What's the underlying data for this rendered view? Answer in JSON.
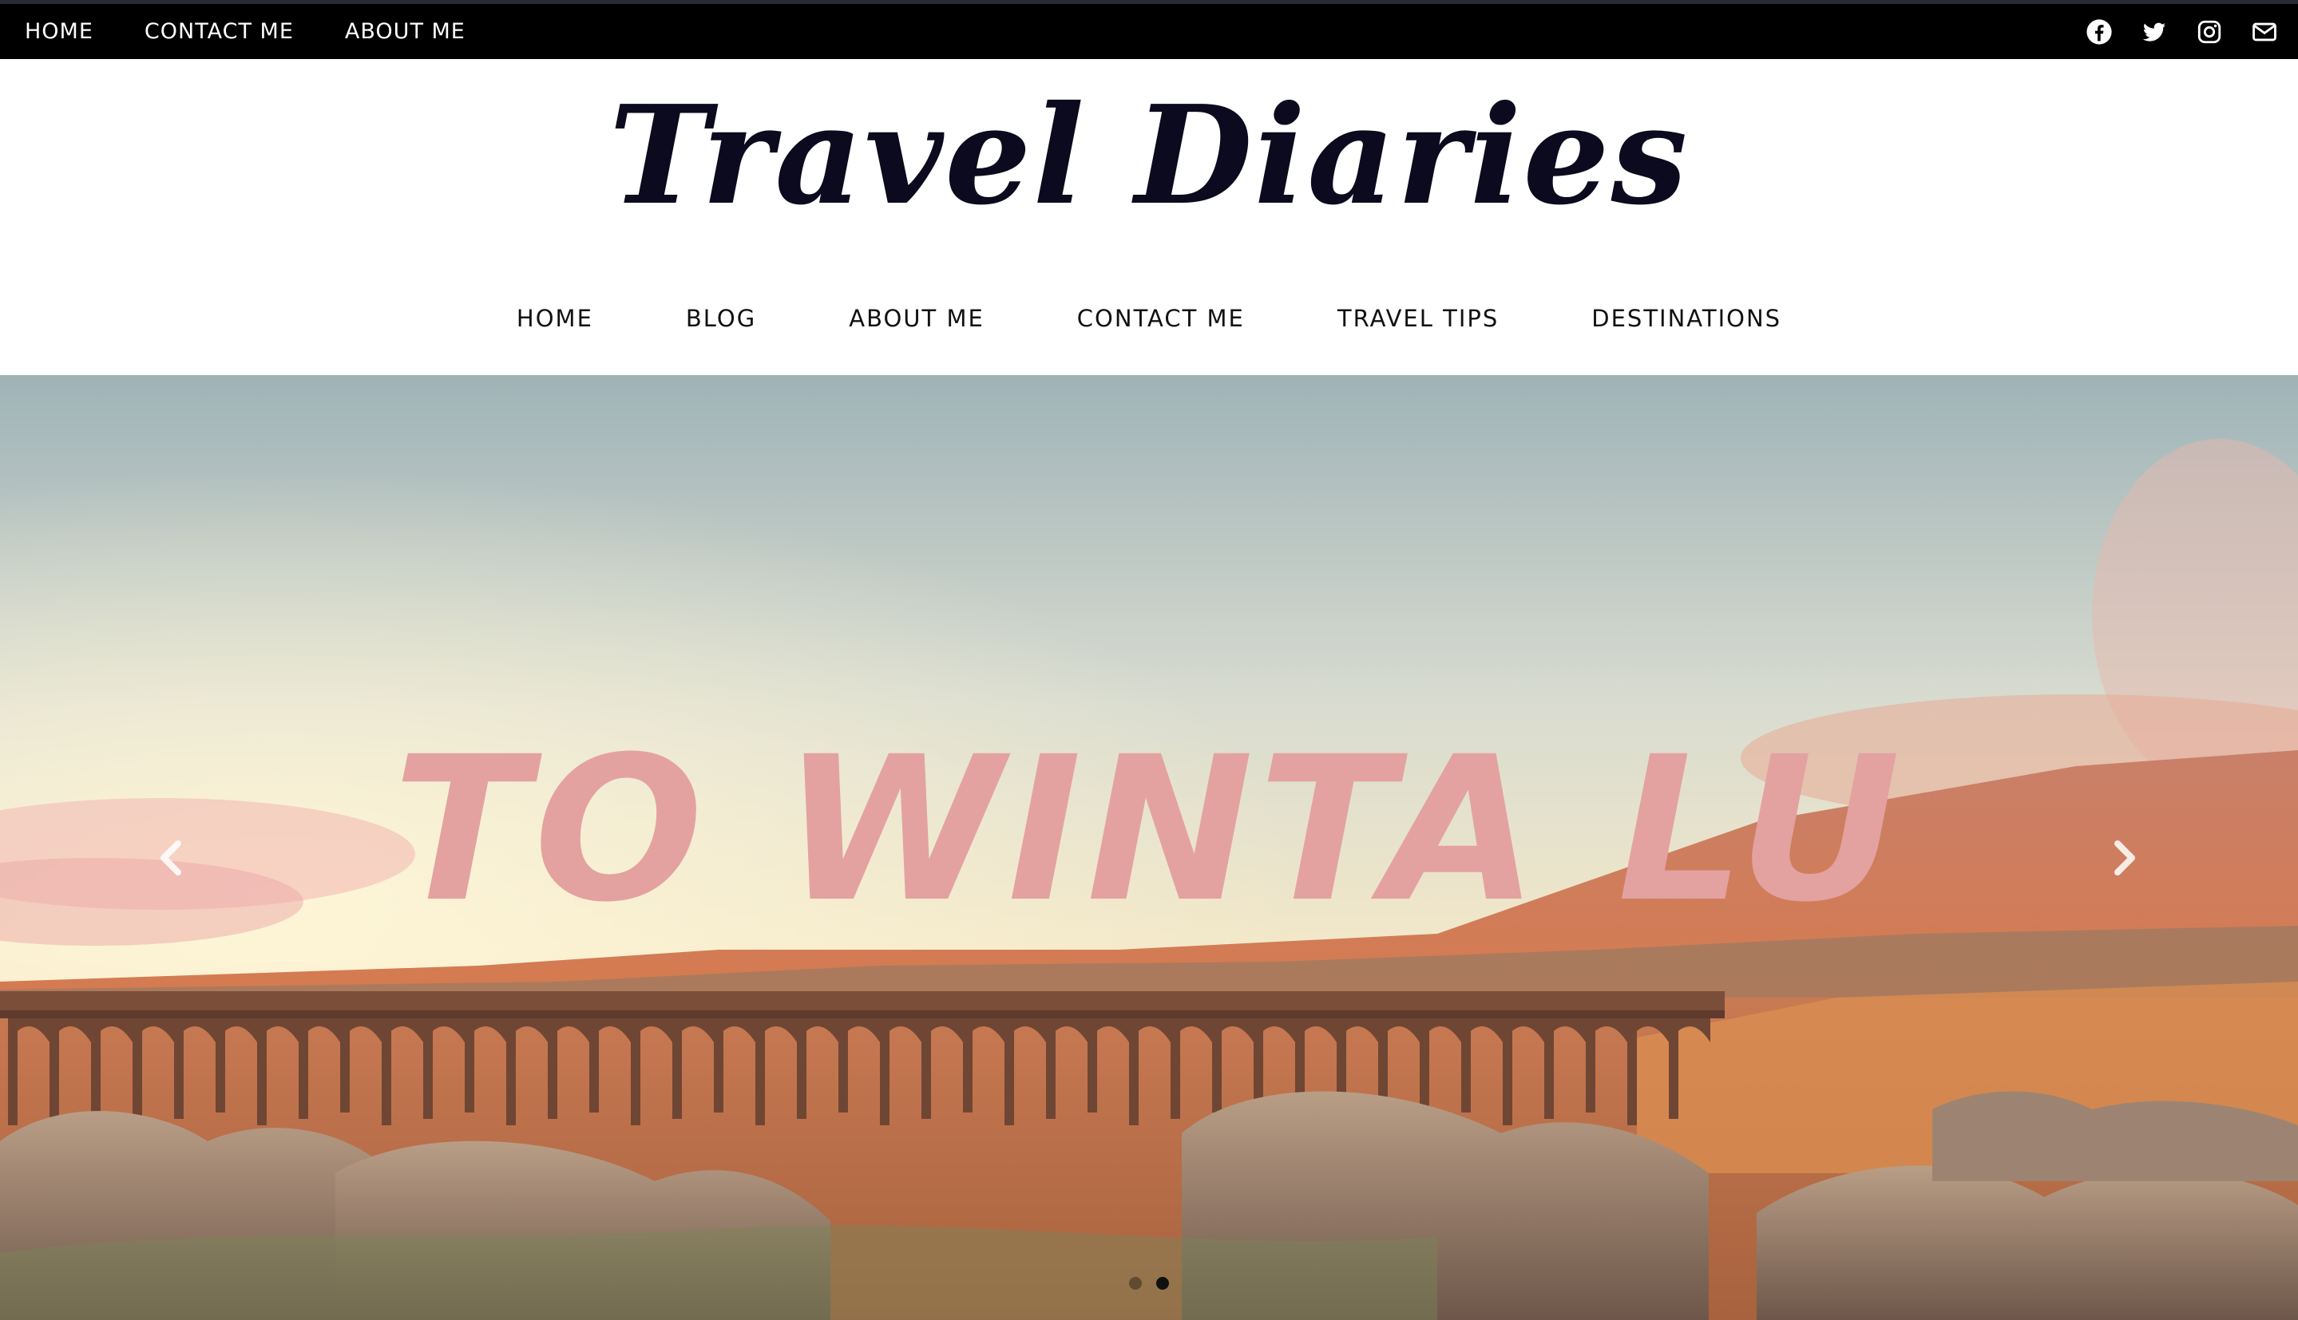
{
  "topbar": {
    "links": [
      "HOME",
      "CONTACT ME",
      "ABOUT ME"
    ],
    "social_icons": [
      "facebook-icon",
      "twitter-icon",
      "instagram-icon",
      "email-icon"
    ]
  },
  "header": {
    "site_title": "Travel Diaries"
  },
  "main_nav": {
    "items": [
      "HOME",
      "BLOG",
      "ABOUT ME",
      "CONTACT ME",
      "TRAVEL TIPS",
      "DESTINATIONS"
    ]
  },
  "hero": {
    "caption": "TO WINTA LU",
    "caption_color": "#e3a2a0",
    "prev_icon": "chevron-left-icon",
    "next_icon": "chevron-right-icon",
    "slide_count": 2,
    "active_slide": 2
  },
  "colors": {
    "topbar_bg": "#000000",
    "title_color": "#0b0a1e",
    "nav_text": "#111111"
  }
}
